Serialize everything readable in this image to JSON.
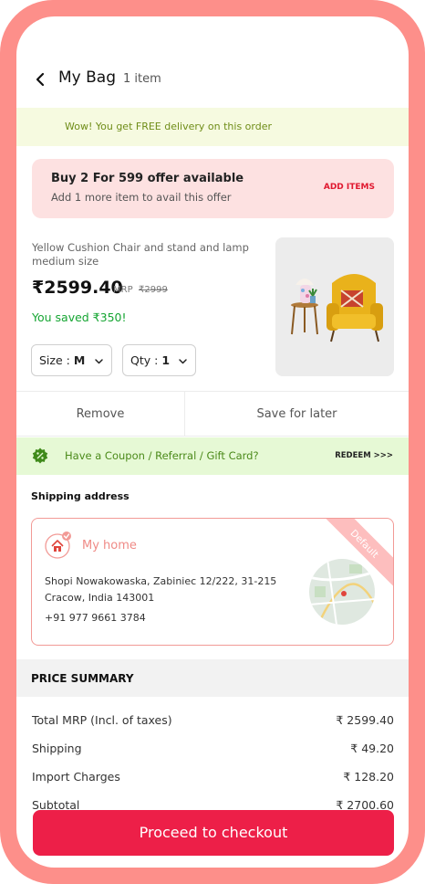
{
  "header": {
    "title": "My Bag",
    "count": "1 item"
  },
  "delivery": {
    "message": "Wow! You get FREE delivery on this order"
  },
  "offer": {
    "title": "Buy 2 For 599 offer available",
    "subtitle": "Add 1 more item to avail this offer",
    "action": "ADD ITEMS"
  },
  "product": {
    "name": "Yellow Cushion Chair and stand and lamp medium size",
    "price": "₹2599.40",
    "mrp_label": "MRP",
    "mrp": "₹2999",
    "saved": "You saved ₹350!",
    "size_label": "Size :",
    "size_value": "M",
    "qty_label": "Qty :",
    "qty_value": "1"
  },
  "actions": {
    "remove": "Remove",
    "save_later": "Save for later"
  },
  "coupon": {
    "text": "Have a Coupon / Referral / Gift Card?",
    "action": "REDEEM >>>"
  },
  "shipping": {
    "label": "Shipping address",
    "name": "My home",
    "line1": "Shopi Nowakowaska, Zabiniec 12/222, 31-215",
    "line2": "Cracow, India 143001",
    "phone": "+91 977 9661 3784",
    "badge": "Default"
  },
  "price_summary": {
    "title": "PRICE SUMMARY",
    "rows": [
      {
        "label": "Total MRP (Incl. of taxes)",
        "value": "₹ 2599.40"
      },
      {
        "label": "Shipping",
        "value": "₹ 49.20"
      },
      {
        "label": "Import Charges",
        "value": "₹ 128.20"
      },
      {
        "label": "Subtotal",
        "value": "₹ 2700.60"
      }
    ]
  },
  "checkout": {
    "label": "Proceed to checkout"
  },
  "colors": {
    "accent": "#ed1f48",
    "frame": "#fd8f8a",
    "success": "#15a532",
    "delivery_bg": "#f6fae0",
    "coupon_bg": "#e6f9d5"
  }
}
